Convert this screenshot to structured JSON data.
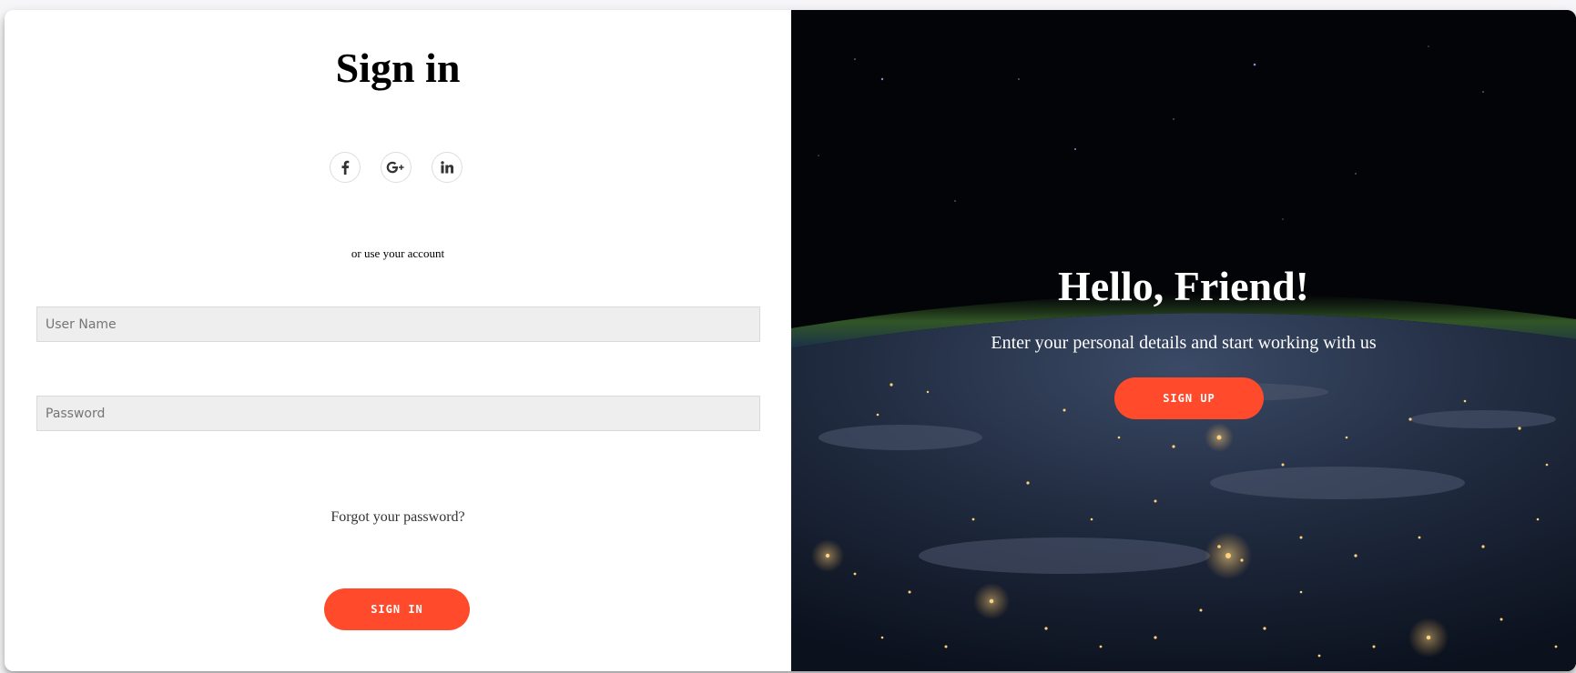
{
  "signin": {
    "title": "Sign in",
    "social": [
      {
        "name": "facebook",
        "icon": "facebook-icon"
      },
      {
        "name": "google-plus",
        "icon": "google-plus-icon"
      },
      {
        "name": "linkedin",
        "icon": "linkedin-icon"
      }
    ],
    "hint": "or use your account",
    "username_placeholder": "User Name",
    "username_value": "",
    "password_placeholder": "Password",
    "password_value": "",
    "forgot_label": "Forgot your password?",
    "signin_label": "SIGN IN"
  },
  "overlay": {
    "title": "Hello, Friend!",
    "text": "Enter your personal details and start working with us",
    "signup_label": "SIGN UP",
    "background": "earth-at-night-from-space"
  },
  "colors": {
    "accent": "#ff4b2b",
    "input_bg": "#eeeeee",
    "panel_bg": "#ffffff"
  }
}
